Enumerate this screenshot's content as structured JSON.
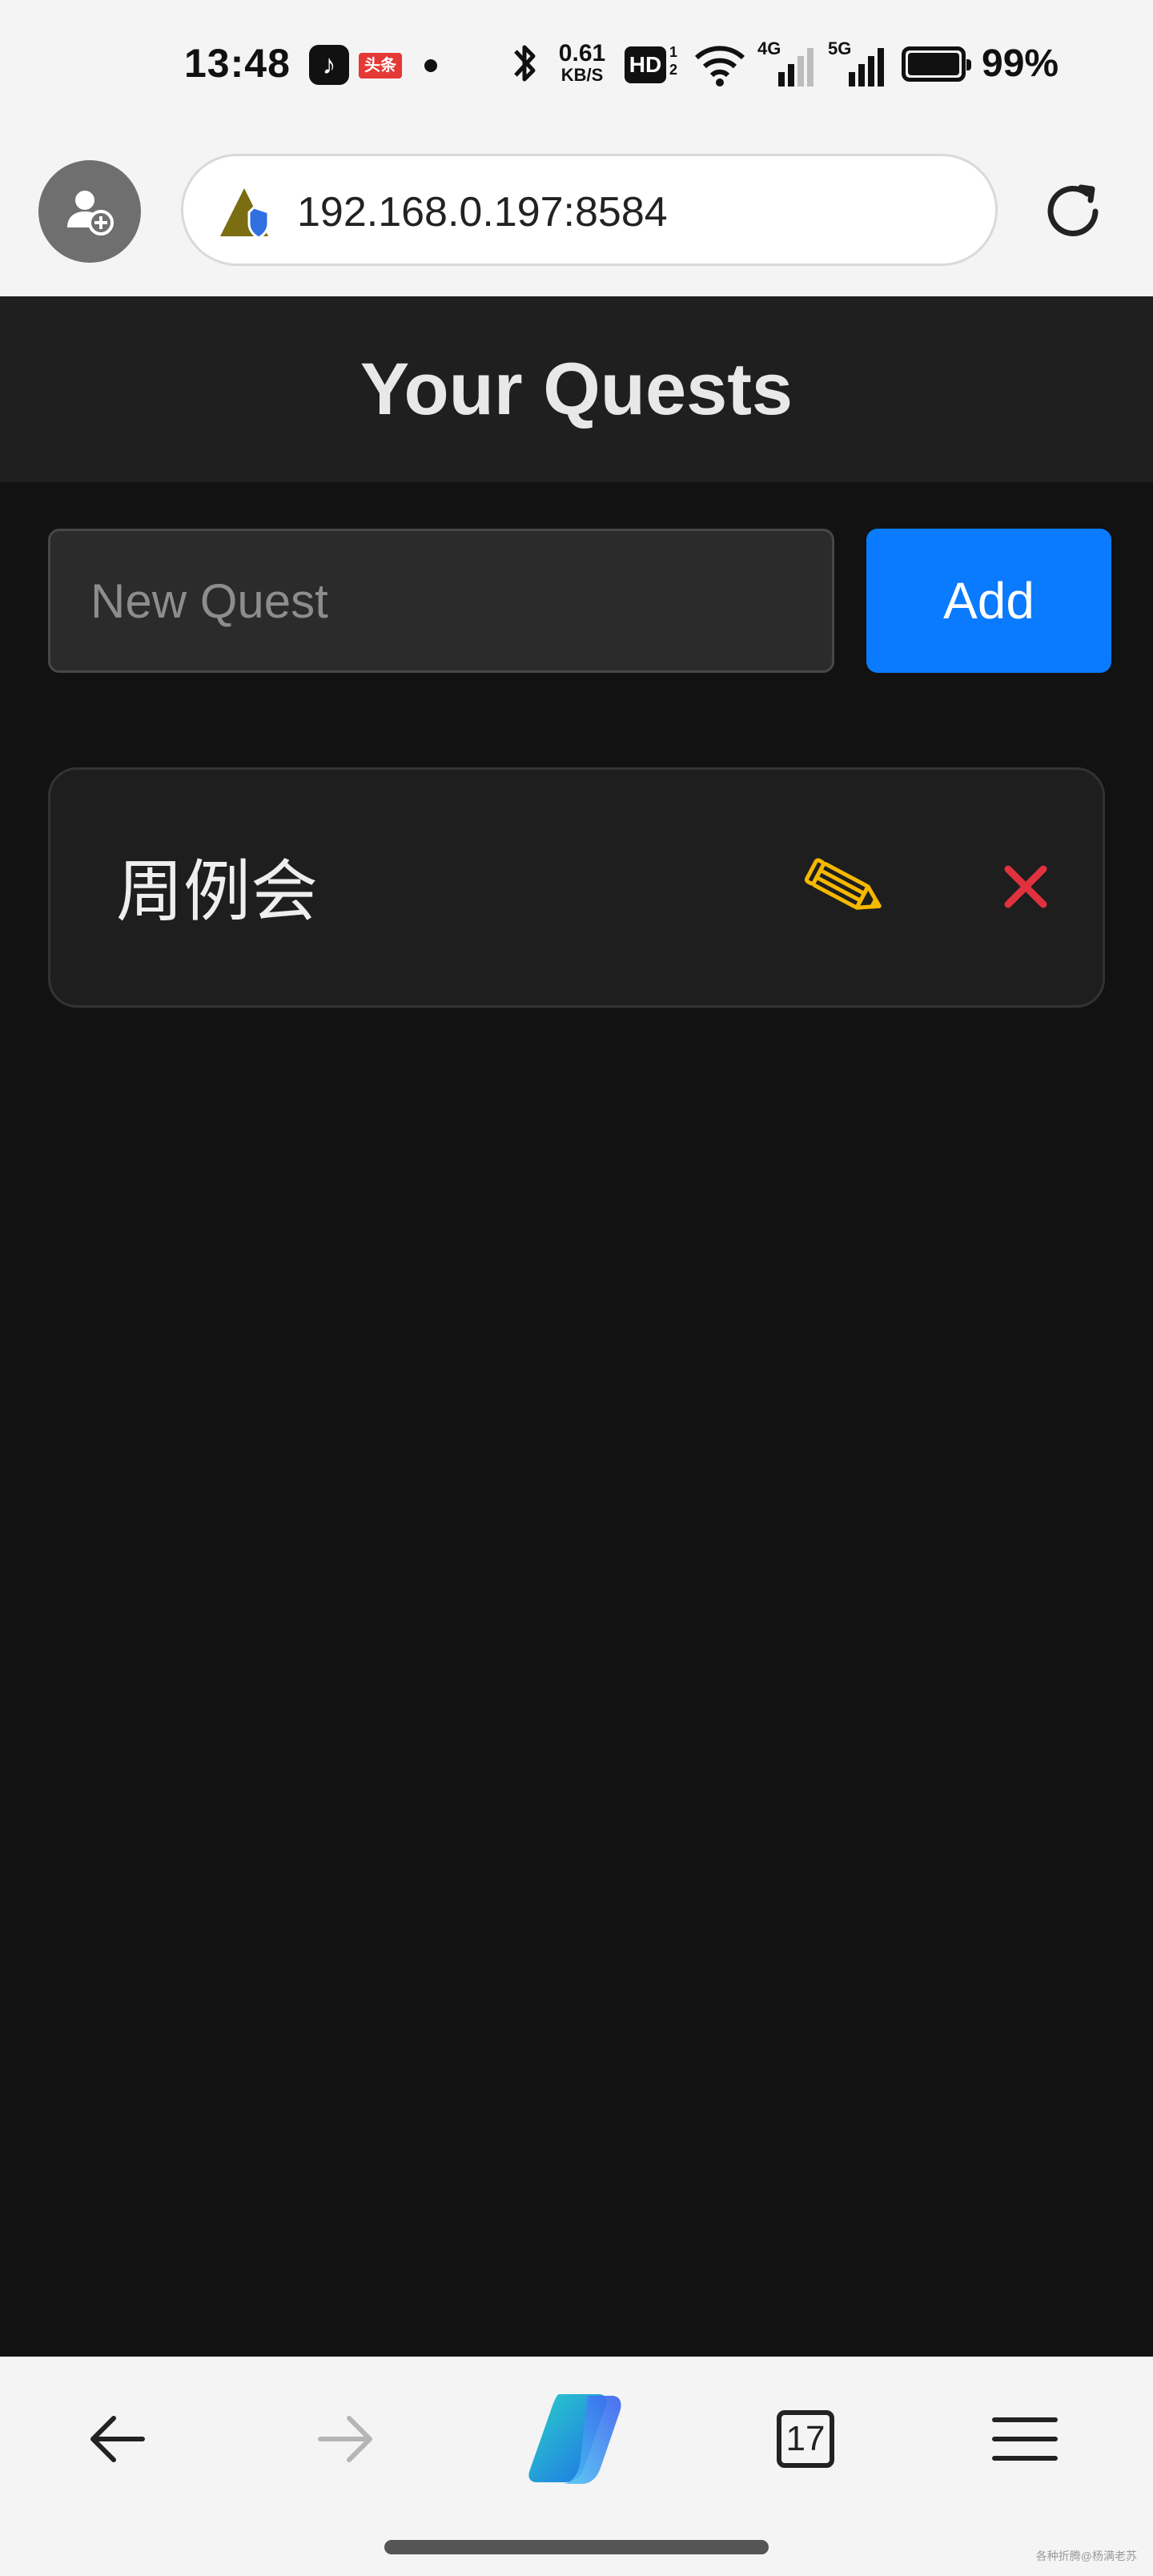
{
  "status_bar": {
    "time": "13:48",
    "app_badge_tiktok": "♪",
    "app_badge_toutiao": "头条",
    "net_speed_value": "0.61",
    "net_speed_unit": "KB/S",
    "hd_label": "HD",
    "hd_sub": "1\n2",
    "signal_1_label": "4G",
    "signal_2_label": "5G",
    "battery_percent": "99%"
  },
  "browser": {
    "url": "192.168.0.197:8584",
    "tab_count": "17"
  },
  "app": {
    "title": "Your Quests",
    "new_quest_placeholder": "New Quest",
    "new_quest_value": "",
    "add_label": "Add",
    "quests": [
      {
        "name": "周例会"
      }
    ]
  },
  "footer": {
    "watermark": "各种折腾@杨满老苏"
  },
  "colors": {
    "page_bg": "#121212",
    "header_bg": "#1f1f1f",
    "accent_blue": "#0a7bff",
    "edit_yellow": "#f5b800",
    "delete_red": "#e0313f"
  }
}
